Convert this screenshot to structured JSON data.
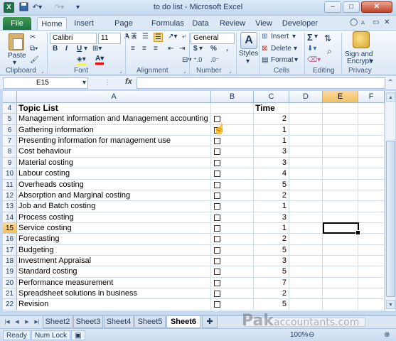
{
  "window": {
    "title": "to do list - Microsoft Excel",
    "app_icon": "X",
    "min": "–",
    "max": "□",
    "close": "✕"
  },
  "tabs": [
    "File",
    "Home",
    "Insert",
    "Page Layout",
    "Formulas",
    "Data",
    "Review",
    "View",
    "Developer"
  ],
  "ribbon": {
    "clipboard": {
      "label": "Clipboard",
      "paste": "Paste"
    },
    "font": {
      "label": "Font",
      "name": "Calibri",
      "size": "11",
      "bold": "B",
      "italic": "I",
      "underline": "U",
      "grow": "A",
      "shrink": "A"
    },
    "alignment": {
      "label": "Alignment"
    },
    "number": {
      "label": "Number",
      "format": "General",
      "currency": "$",
      "percent": "%",
      "comma": ","
    },
    "styles": {
      "label": "Styles"
    },
    "cells": {
      "label": "Cells",
      "insert": "Insert",
      "delete": "Delete",
      "format": "Format"
    },
    "editing": {
      "label": "Editing",
      "sum": "Σ"
    },
    "privacy": {
      "label": "Privacy",
      "sign": "Sign and",
      "encrypt": "Encrypt"
    }
  },
  "formula_bar": {
    "name_box": "E15",
    "fx": "fx",
    "formula": ""
  },
  "columns": [
    "A",
    "B",
    "C",
    "D",
    "E",
    "F"
  ],
  "active_column": "E",
  "active_row": "15",
  "header_row": {
    "row": "4",
    "topic": "Topic List",
    "time": "Time"
  },
  "rows": [
    {
      "row": "5",
      "topic": "Management information and Management accounting",
      "time": "2"
    },
    {
      "row": "6",
      "topic": "Gathering information",
      "time": "1"
    },
    {
      "row": "7",
      "topic": "Presenting information for management use",
      "time": "1"
    },
    {
      "row": "8",
      "topic": "Cost behaviour",
      "time": "3"
    },
    {
      "row": "9",
      "topic": "Material costing",
      "time": "3"
    },
    {
      "row": "10",
      "topic": "Labour costing",
      "time": "4"
    },
    {
      "row": "11",
      "topic": "Overheads costing",
      "time": "5"
    },
    {
      "row": "12",
      "topic": "Absorption and Marginal costing",
      "time": "2"
    },
    {
      "row": "13",
      "topic": "Job and Batch costing",
      "time": "1"
    },
    {
      "row": "14",
      "topic": "Process costing",
      "time": "3"
    },
    {
      "row": "15",
      "topic": "Service costing",
      "time": "1"
    },
    {
      "row": "16",
      "topic": "Forecasting",
      "time": "2"
    },
    {
      "row": "17",
      "topic": "Budgeting",
      "time": "5"
    },
    {
      "row": "18",
      "topic": "Investment Appraisal",
      "time": "3"
    },
    {
      "row": "19",
      "topic": "Standard costing",
      "time": "5"
    },
    {
      "row": "20",
      "topic": "Performance measurement",
      "time": "7"
    },
    {
      "row": "21",
      "topic": "Spreadsheet solutions in business",
      "time": "2"
    },
    {
      "row": "22",
      "topic": "Revision",
      "time": "5"
    }
  ],
  "sheet_tabs": [
    "Sheet2",
    "Sheet3",
    "Sheet4",
    "Sheet5",
    "Sheet6"
  ],
  "active_sheet": "Sheet6",
  "status": {
    "ready": "Ready",
    "num_lock": "Num Lock",
    "zoom": "100%"
  },
  "watermark": {
    "brand": "Pak",
    "rest": "accountants.com"
  }
}
